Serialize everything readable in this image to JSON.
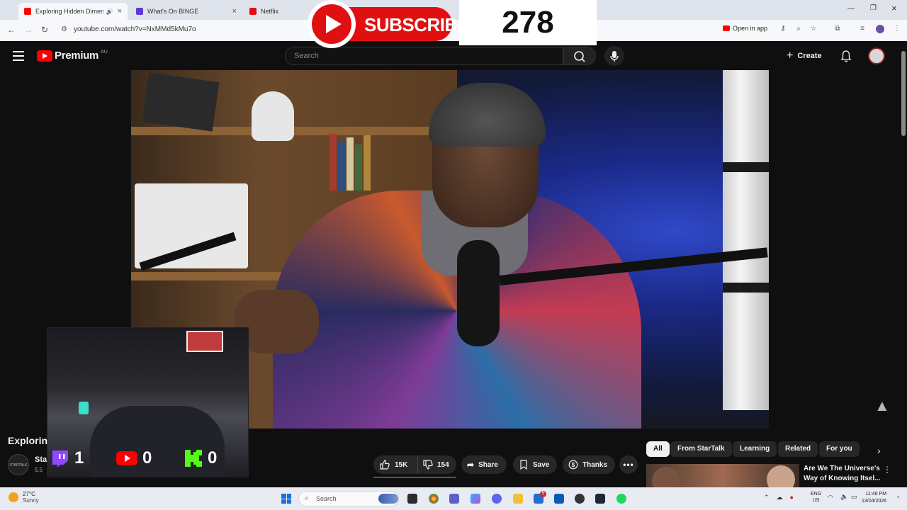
{
  "browser": {
    "tabs": [
      {
        "label": "Exploring Hidden Dimensio",
        "favicon_color": "#ff0000",
        "active": true
      },
      {
        "label": "What's On BINGE",
        "favicon_color": "#5b3bd6",
        "active": false
      },
      {
        "label": "Netflix",
        "favicon_color": "#e50914",
        "active": false
      }
    ],
    "url": "youtube.com/watch?v=NxMMd5kMu7o",
    "open_in_app_label": "Open in app"
  },
  "overlays": {
    "subscribe_label": "SUBSCRIBE",
    "subscriber_counter": "278"
  },
  "youtube": {
    "brand": "Premium",
    "region": "AU",
    "search_placeholder": "Search",
    "create_label": "Create"
  },
  "stream_stats": {
    "twitch_count": "1",
    "youtube_count": "0",
    "kick_count": "0"
  },
  "video": {
    "title_fragment": "Explorin",
    "channel_name_fragment": "Sta",
    "subscribers_fragment": "5.5",
    "channel_avatar_text": "STARTALK",
    "likes": "15K",
    "dislikes": "154",
    "share_label": "Share",
    "save_label": "Save",
    "thanks_label": "Thanks"
  },
  "chips": [
    "All",
    "From StarTalk",
    "Learning",
    "Related",
    "For you"
  ],
  "recommendation": {
    "title": "Are We The Universe's Way of Knowing Itsel..."
  },
  "taskbar": {
    "temperature": "27°C",
    "condition": "Sunny",
    "search_placeholder": "Search",
    "language_top": "ENG",
    "language_bottom": "US",
    "time": "11:46 PM",
    "date": "13/04/2026",
    "badge_count": "5"
  },
  "colors": {
    "yt_red": "#ff0000",
    "twitch_purple": "#9146ff",
    "kick_green": "#53fc18",
    "page_bg": "#0f0f0f"
  }
}
